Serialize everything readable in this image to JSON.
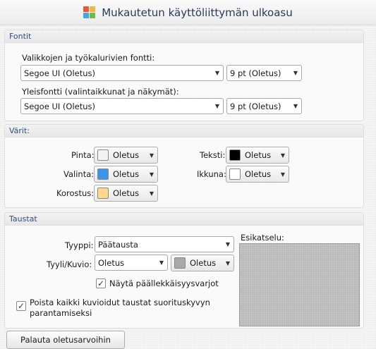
{
  "window": {
    "title": "Mukautetun käyttöliittymän ulkoasu"
  },
  "fonts": {
    "header": "Fontit",
    "menu_label": "Valikkojen ja työkalurivien fontti:",
    "menu_font": "Segoe UI (Oletus)",
    "menu_size": "9 pt (Oletus)",
    "general_label": "Yleisfontti (valintaikkunat ja näkymät):",
    "general_font": "Segoe UI (Oletus)",
    "general_size": "9 pt (Oletus)"
  },
  "colors": {
    "header": "Värit:",
    "items": {
      "pinta": {
        "label": "Pinta:",
        "value": "Oletus",
        "color": "#f3f3f3"
      },
      "valinta": {
        "label": "Valinta:",
        "value": "Oletus",
        "color": "#3d95ea"
      },
      "korostus": {
        "label": "Korostus:",
        "value": "Oletus",
        "color": "#ffd98a"
      },
      "teksti": {
        "label": "Teksti:",
        "value": "Oletus",
        "color": "#000000"
      },
      "ikkuna": {
        "label": "Ikkuna:",
        "value": "Oletus",
        "color": "#ffffff"
      }
    }
  },
  "backgrounds": {
    "header": "Taustat",
    "type_label": "Tyyppi:",
    "type_value": "Päätausta",
    "style_label": "Tyyli/Kuvio:",
    "style_value": "Oletus",
    "style_color_value": "Oletus",
    "style_color": "#a9a9a9",
    "shadows_label": "Näytä päällekkäisyysvarjot",
    "shadows_checked": true,
    "remove_label_line1": "Poista kaikki kuvioidut taustat suorituskyvyn",
    "remove_label_line2": "parantamiseksi",
    "remove_checked": true,
    "preview_label": "Esikatselu:"
  },
  "footer": {
    "reset_button": "Palauta oletusarvoihin"
  },
  "icons": {
    "dropdown": "chevron-down-icon",
    "check": "checkmark-icon",
    "app": "palette-cursor-icon"
  },
  "check_glyph": "✓",
  "arrow_glyph": "▼"
}
